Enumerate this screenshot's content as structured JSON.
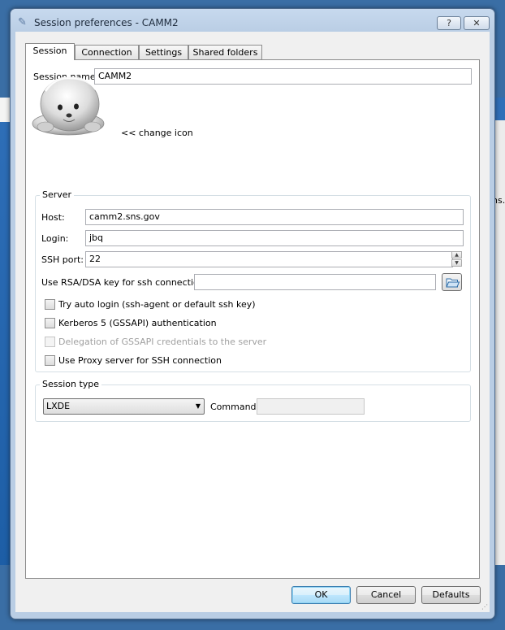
{
  "window": {
    "title": "Session preferences - CAMM2",
    "help_glyph": "?",
    "close_glyph": "✕"
  },
  "tabs": [
    {
      "label": "Session",
      "active": true
    },
    {
      "label": "Connection",
      "active": false
    },
    {
      "label": "Settings",
      "active": false
    },
    {
      "label": "Shared folders",
      "active": false
    }
  ],
  "session": {
    "name_label": "Session name:",
    "name_value": "CAMM2",
    "change_icon_label": "<< change icon"
  },
  "server": {
    "group_title": "Server",
    "host_label": "Host:",
    "host_value": "camm2.sns.gov",
    "login_label": "Login:",
    "login_value": "jbq",
    "port_label": "SSH port:",
    "port_value": "22",
    "rsa_label": "Use RSA/DSA key for ssh connection:",
    "rsa_value": "",
    "checkboxes": [
      {
        "label": "Try auto login (ssh-agent or default ssh key)",
        "checked": false,
        "enabled": true
      },
      {
        "label": "Kerberos 5 (GSSAPI) authentication",
        "checked": false,
        "enabled": true
      },
      {
        "label": "Delegation of GSSAPI credentials to the server",
        "checked": false,
        "enabled": false
      },
      {
        "label": "Use Proxy server for SSH connection",
        "checked": false,
        "enabled": true
      }
    ]
  },
  "session_type": {
    "group_title": "Session type",
    "selected": "LXDE",
    "command_label": "Command:",
    "command_value": ""
  },
  "buttons": {
    "ok": "OK",
    "cancel": "Cancel",
    "defaults": "Defaults"
  },
  "background": {
    "right_fragment": "ns."
  },
  "colors": {
    "title_bar": "#c7d9ee",
    "panel": "#ffffff",
    "default_button": "#bee6fd",
    "desktop": "#3a6ea5"
  }
}
